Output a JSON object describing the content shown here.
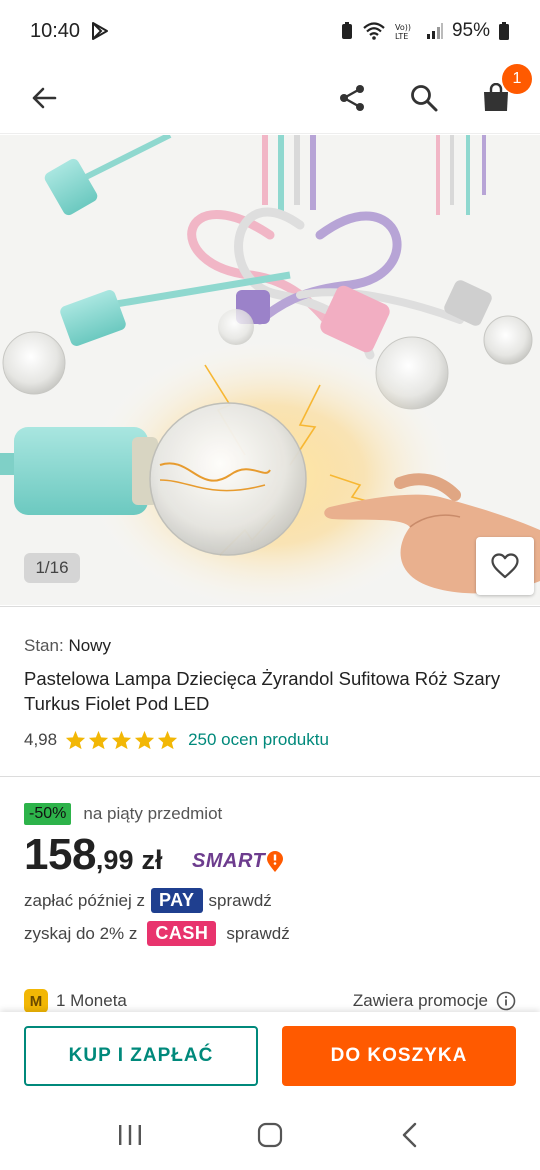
{
  "status_bar": {
    "time": "10:40",
    "battery": "95%"
  },
  "app_bar": {
    "cart_count": "1",
    "icons": [
      "back-arrow-icon",
      "share-icon",
      "search-icon",
      "shopping-bag-icon"
    ]
  },
  "gallery": {
    "counter": "1/16"
  },
  "product": {
    "condition_label": "Stan:",
    "condition_value": "Nowy",
    "title": "Pastelowa Lampa Dziecięca Żyrandol Sufitowa Róż Szary Turkus Fiolet Pod LED",
    "rating_value": "4,98",
    "rating_stars": 5,
    "rating_link": "250 ocen produktu"
  },
  "pricing": {
    "discount_badge": "-50%",
    "discount_text": "na piąty przedmiot",
    "price_integer": "158",
    "price_decimal": ",99",
    "currency": "zł",
    "smart_label": "SMART",
    "pay_prefix": "zapłać później z",
    "pay_badge": "PAY",
    "pay_link": "sprawdź",
    "cash_prefix": "zyskaj do 2% z",
    "cash_badge": "CASH",
    "cash_link": "sprawdź",
    "coin_badge": "M",
    "coin_text": "1 Moneta",
    "promo_text": "Zawiera promocje"
  },
  "actions": {
    "buy_now": "KUP I ZAPŁAĆ",
    "add_to_cart": "DO KOSZYKA"
  },
  "colors": {
    "accent_orange": "#ff5a00",
    "accent_teal": "#00897b",
    "discount_green": "#2db34a",
    "pay_blue": "#1f3f8f",
    "cash_pink": "#e8336d",
    "smart_purple": "#6d3c8e"
  }
}
